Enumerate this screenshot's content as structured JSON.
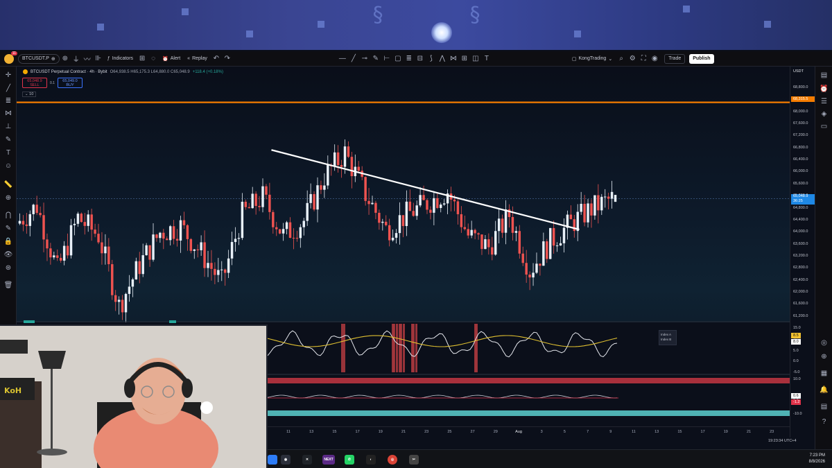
{
  "toolbar": {
    "notification_count": "11",
    "symbol": "BTCUSDT.P",
    "indicators_label": "Indicators",
    "alert_label": "Alert",
    "replay_label": "Replay",
    "account_label": "KongTrading",
    "trade_label": "Trade",
    "publish_label": "Publish"
  },
  "legend": {
    "title": "BTCUSDT Perpetual Contract · 4h · Bybit",
    "ohlc": "O64,938.5 H65,175.3 L64,880.0 C65,048.9",
    "change": "+118.4 (+0.18%)"
  },
  "order": {
    "sell_price": "65,048.9",
    "sell_label": "SELL",
    "buy_price": "65,049.0",
    "buy_label": "BUY",
    "spread": "0.1",
    "quantity": "10"
  },
  "price_scale": {
    "currency": "USDT",
    "labels": [
      "68,800.0",
      "68,400.0",
      "68,000.0",
      "67,600.0",
      "67,200.0",
      "66,800.0",
      "66,400.0",
      "66,000.0",
      "65,600.0",
      "65,200.0",
      "64,800.0",
      "64,400.0",
      "64,000.0",
      "63,600.0",
      "63,200.0",
      "62,800.0",
      "62,400.0",
      "62,000.0",
      "61,600.0",
      "61,200.0"
    ],
    "orange_line_label": "68,315.5",
    "current_price": "65,048.9",
    "countdown": "36:25"
  },
  "oscillator": {
    "scale": [
      "15.0",
      "10.0",
      "5.0",
      "0.0",
      "-5.0"
    ],
    "values": [
      "8.5",
      "8.0"
    ],
    "legend_items": [
      "Index A",
      "Index B"
    ]
  },
  "lower_pane": {
    "scale": [
      "10.0",
      "0.0",
      "-10.0"
    ],
    "values": [
      "0.6",
      "-1.2"
    ]
  },
  "time_axis": {
    "labels": [
      "11",
      "13",
      "15",
      "17",
      "19",
      "21",
      "23",
      "25",
      "27",
      "29",
      "Aug",
      "3",
      "5",
      "7",
      "9",
      "11",
      "13",
      "15",
      "17",
      "19",
      "21",
      "23"
    ]
  },
  "clock": "19:23:34 UTC+4",
  "taskbar": {
    "time": "7:23 PM",
    "date": "8/8/2026",
    "apps": [
      "NEXT"
    ]
  },
  "colors": {
    "orange_line": "#f57c00",
    "up_candle": "#e8f0f8",
    "down_candle": "#ef5350",
    "trendline": "#ffffff",
    "accent_blue": "#3b73ff"
  },
  "chart_data": {
    "type": "candlestick",
    "title": "BTCUSDT Perpetual Contract · 4h · Bybit",
    "x": [
      "Jul 10",
      "Jul 11",
      "Jul 12",
      "Jul 13",
      "Jul 14",
      "Jul 15",
      "Jul 16",
      "Jul 17",
      "Jul 18",
      "Jul 19",
      "Jul 20",
      "Jul 21",
      "Jul 22",
      "Jul 23",
      "Jul 24",
      "Jul 25",
      "Jul 26",
      "Jul 27",
      "Jul 28",
      "Jul 29",
      "Jul 30",
      "Jul 31",
      "Aug 1",
      "Aug 2",
      "Aug 3",
      "Aug 4",
      "Aug 5",
      "Aug 6",
      "Aug 7",
      "Aug 8"
    ],
    "y": [
      64200,
      64800,
      62600,
      64400,
      63800,
      61400,
      62800,
      63900,
      64100,
      63200,
      62200,
      64500,
      65100,
      63800,
      64300,
      65800,
      66600,
      65200,
      64000,
      64500,
      64900,
      65300,
      63800,
      63400,
      64500,
      62600,
      63600,
      64200,
      64700,
      65049
    ],
    "ylim": [
      61000,
      69000
    ],
    "trendline": {
      "start": [
        "Jul 22",
        66700
      ],
      "end": [
        "Aug 7",
        64000
      ]
    },
    "horizontal_line": 68315.5
  }
}
